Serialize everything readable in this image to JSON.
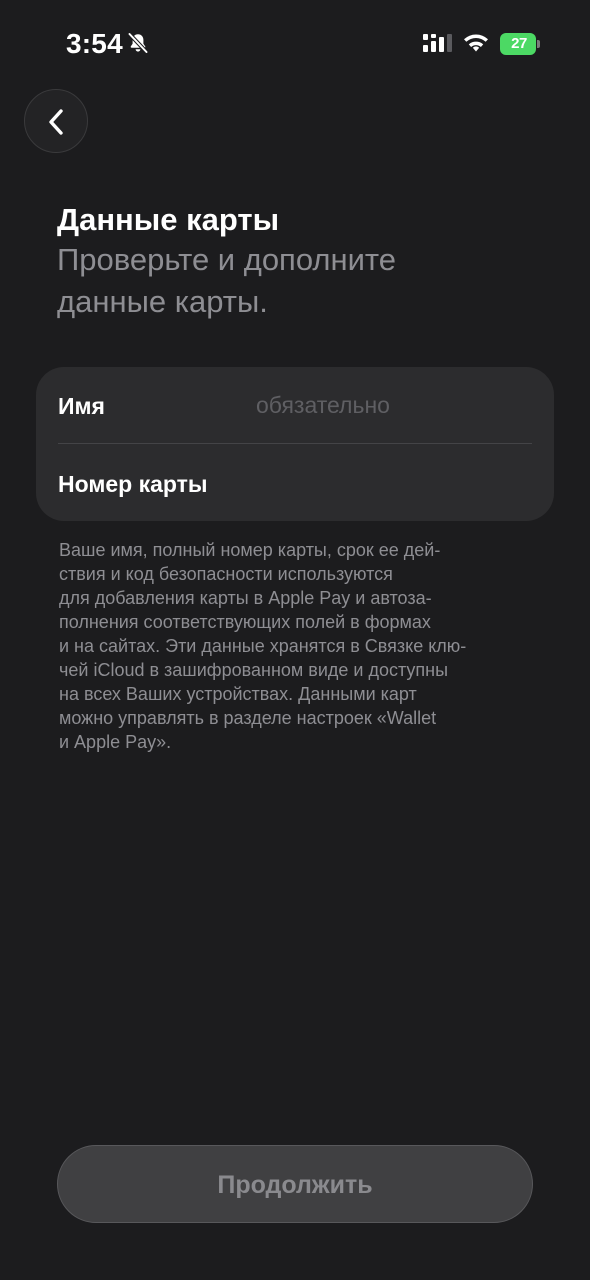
{
  "status_bar": {
    "time": "3:54",
    "battery_level": "27",
    "icons": [
      "bell-slash-icon",
      "signal-icon",
      "wifi-icon",
      "battery-charging-icon"
    ],
    "battery_color": "#4cd964"
  },
  "nav": {
    "back_icon": "chevron-left-icon"
  },
  "header": {
    "title": "Данные карты",
    "subtitle": "Проверьте и дополните данные карты."
  },
  "form": {
    "name_label": "Имя",
    "name_placeholder": "обязательно",
    "name_value": "",
    "card_number_label": "Номер карты",
    "card_number_value": ""
  },
  "info_text": "Ваше имя, полный номер карты, срок ее дей-\nствия и код безопасности используются\nдля добавления карты в Apple Pay и автоза-\nполнения соответствующих полей в формах\nи на сайтах. Эти данные хранятся в Связке клю-\nчей iCloud в зашифрованном виде и доступны\nна всех Ваших устройствах. Данными карт\nможно управлять в разделе настроек «Wallet\nи Apple Pay».",
  "actions": {
    "continue_label": "Продолжить",
    "continue_enabled": false
  },
  "colors": {
    "background": "#1c1c1e",
    "card": "#2c2c2e",
    "secondary_text": "#8e8e93",
    "disabled_button": "#404042"
  }
}
